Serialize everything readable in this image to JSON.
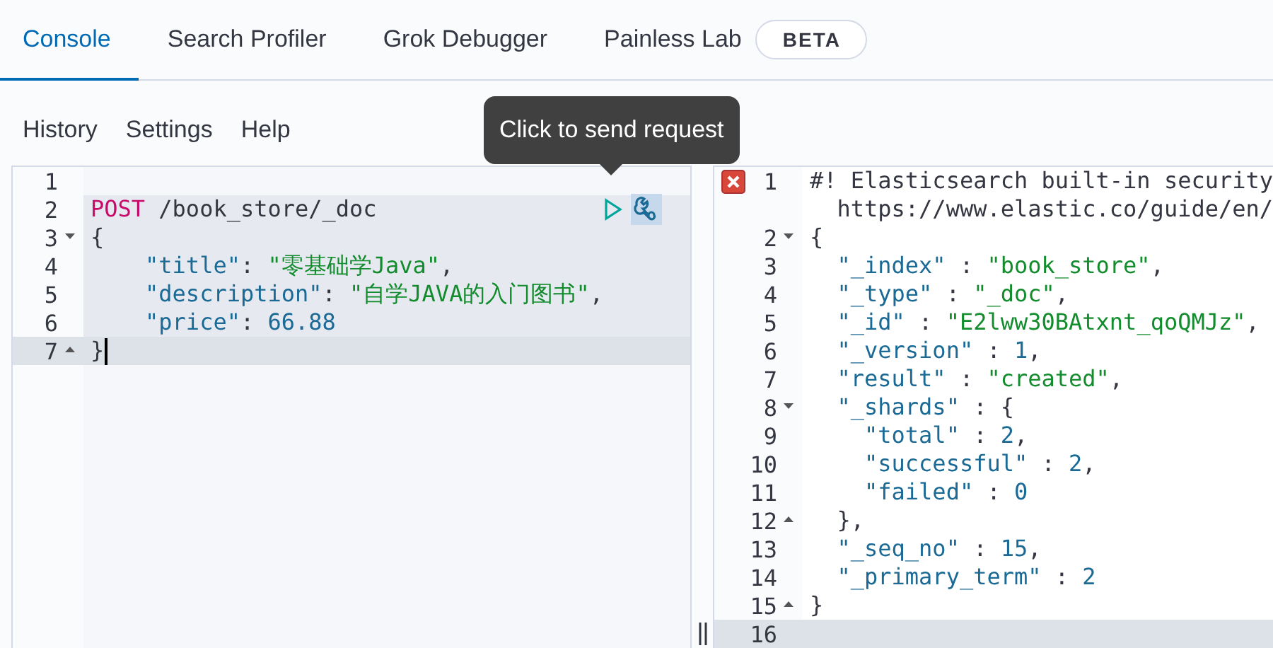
{
  "tabs": [
    {
      "label": "Console",
      "selected": true
    },
    {
      "label": "Search Profiler",
      "selected": false
    },
    {
      "label": "Grok Debugger",
      "selected": false
    },
    {
      "label": "Painless Lab",
      "selected": false,
      "badge": "BETA"
    }
  ],
  "menu": [
    "History",
    "Settings",
    "Help"
  ],
  "tooltip": "Click to send request",
  "request_editor": {
    "lines": [
      {
        "number": "1"
      },
      {
        "number": "2",
        "in_request": true,
        "actions": true,
        "tokens": [
          {
            "kind": "method",
            "text": "POST"
          },
          {
            "kind": "path",
            "text": " /book_store/_doc"
          }
        ]
      },
      {
        "number": "3",
        "in_request": true,
        "fold_start": true,
        "tokens": [
          {
            "kind": "punct",
            "text": "{"
          }
        ]
      },
      {
        "number": "4",
        "in_request": true,
        "tokens": [
          {
            "kind": "key",
            "text": "    \"title\""
          },
          {
            "kind": "punct",
            "text": ": "
          },
          {
            "kind": "string",
            "text": "\"零基础学Java\""
          },
          {
            "kind": "punct",
            "text": ","
          }
        ]
      },
      {
        "number": "5",
        "in_request": true,
        "tokens": [
          {
            "kind": "key",
            "text": "    \"description\""
          },
          {
            "kind": "punct",
            "text": ": "
          },
          {
            "kind": "string",
            "text": "\"自学JAVA的入门图书\""
          },
          {
            "kind": "punct",
            "text": ","
          }
        ]
      },
      {
        "number": "6",
        "in_request": true,
        "tokens": [
          {
            "kind": "key",
            "text": "    \"price\""
          },
          {
            "kind": "punct",
            "text": ": "
          },
          {
            "kind": "number",
            "text": "66.88"
          }
        ]
      },
      {
        "number": "7",
        "in_request": true,
        "active": true,
        "cursor": true,
        "fold_end": true,
        "tokens": [
          {
            "kind": "punct",
            "text": "}"
          }
        ]
      }
    ]
  },
  "response_editor": {
    "lines": [
      {
        "number": "1",
        "error": true,
        "tokens": [
          {
            "kind": "comment",
            "text": "#! Elasticsearch built-in security"
          }
        ],
        "wrapped": "https://www.elastic.co/guide/en/"
      },
      {
        "number": "2",
        "fold_start": true,
        "tokens": [
          {
            "kind": "punct",
            "text": "{"
          }
        ]
      },
      {
        "number": "3",
        "tokens": [
          {
            "kind": "key",
            "text": "  \"_index\""
          },
          {
            "kind": "punct",
            "text": " : "
          },
          {
            "kind": "string",
            "text": "\"book_store\""
          },
          {
            "kind": "punct",
            "text": ","
          }
        ]
      },
      {
        "number": "4",
        "tokens": [
          {
            "kind": "key",
            "text": "  \"_type\""
          },
          {
            "kind": "punct",
            "text": " : "
          },
          {
            "kind": "string",
            "text": "\"_doc\""
          },
          {
            "kind": "punct",
            "text": ","
          }
        ]
      },
      {
        "number": "5",
        "tokens": [
          {
            "kind": "key",
            "text": "  \"_id\""
          },
          {
            "kind": "punct",
            "text": " : "
          },
          {
            "kind": "string",
            "text": "\"E2lww30BAtxnt_qoQMJz\""
          },
          {
            "kind": "punct",
            "text": ","
          }
        ]
      },
      {
        "number": "6",
        "tokens": [
          {
            "kind": "key",
            "text": "  \"_version\""
          },
          {
            "kind": "punct",
            "text": " : "
          },
          {
            "kind": "number",
            "text": "1"
          },
          {
            "kind": "punct",
            "text": ","
          }
        ]
      },
      {
        "number": "7",
        "tokens": [
          {
            "kind": "key",
            "text": "  \"result\""
          },
          {
            "kind": "punct",
            "text": " : "
          },
          {
            "kind": "string",
            "text": "\"created\""
          },
          {
            "kind": "punct",
            "text": ","
          }
        ]
      },
      {
        "number": "8",
        "fold_start": true,
        "tokens": [
          {
            "kind": "key",
            "text": "  \"_shards\""
          },
          {
            "kind": "punct",
            "text": " : {"
          }
        ]
      },
      {
        "number": "9",
        "tokens": [
          {
            "kind": "key",
            "text": "    \"total\""
          },
          {
            "kind": "punct",
            "text": " : "
          },
          {
            "kind": "number",
            "text": "2"
          },
          {
            "kind": "punct",
            "text": ","
          }
        ]
      },
      {
        "number": "10",
        "tokens": [
          {
            "kind": "key",
            "text": "    \"successful\""
          },
          {
            "kind": "punct",
            "text": " : "
          },
          {
            "kind": "number",
            "text": "2"
          },
          {
            "kind": "punct",
            "text": ","
          }
        ]
      },
      {
        "number": "11",
        "tokens": [
          {
            "kind": "key",
            "text": "    \"failed\""
          },
          {
            "kind": "punct",
            "text": " : "
          },
          {
            "kind": "number",
            "text": "0"
          }
        ]
      },
      {
        "number": "12",
        "fold_end": true,
        "tokens": [
          {
            "kind": "punct",
            "text": "  },"
          }
        ]
      },
      {
        "number": "13",
        "tokens": [
          {
            "kind": "key",
            "text": "  \"_seq_no\""
          },
          {
            "kind": "punct",
            "text": " : "
          },
          {
            "kind": "number",
            "text": "15"
          },
          {
            "kind": "punct",
            "text": ","
          }
        ]
      },
      {
        "number": "14",
        "tokens": [
          {
            "kind": "key",
            "text": "  \"_primary_term\""
          },
          {
            "kind": "punct",
            "text": " : "
          },
          {
            "kind": "number",
            "text": "2"
          }
        ]
      },
      {
        "number": "15",
        "fold_end": true,
        "tokens": [
          {
            "kind": "punct",
            "text": "}"
          }
        ]
      },
      {
        "number": "16",
        "active": true
      }
    ]
  }
}
